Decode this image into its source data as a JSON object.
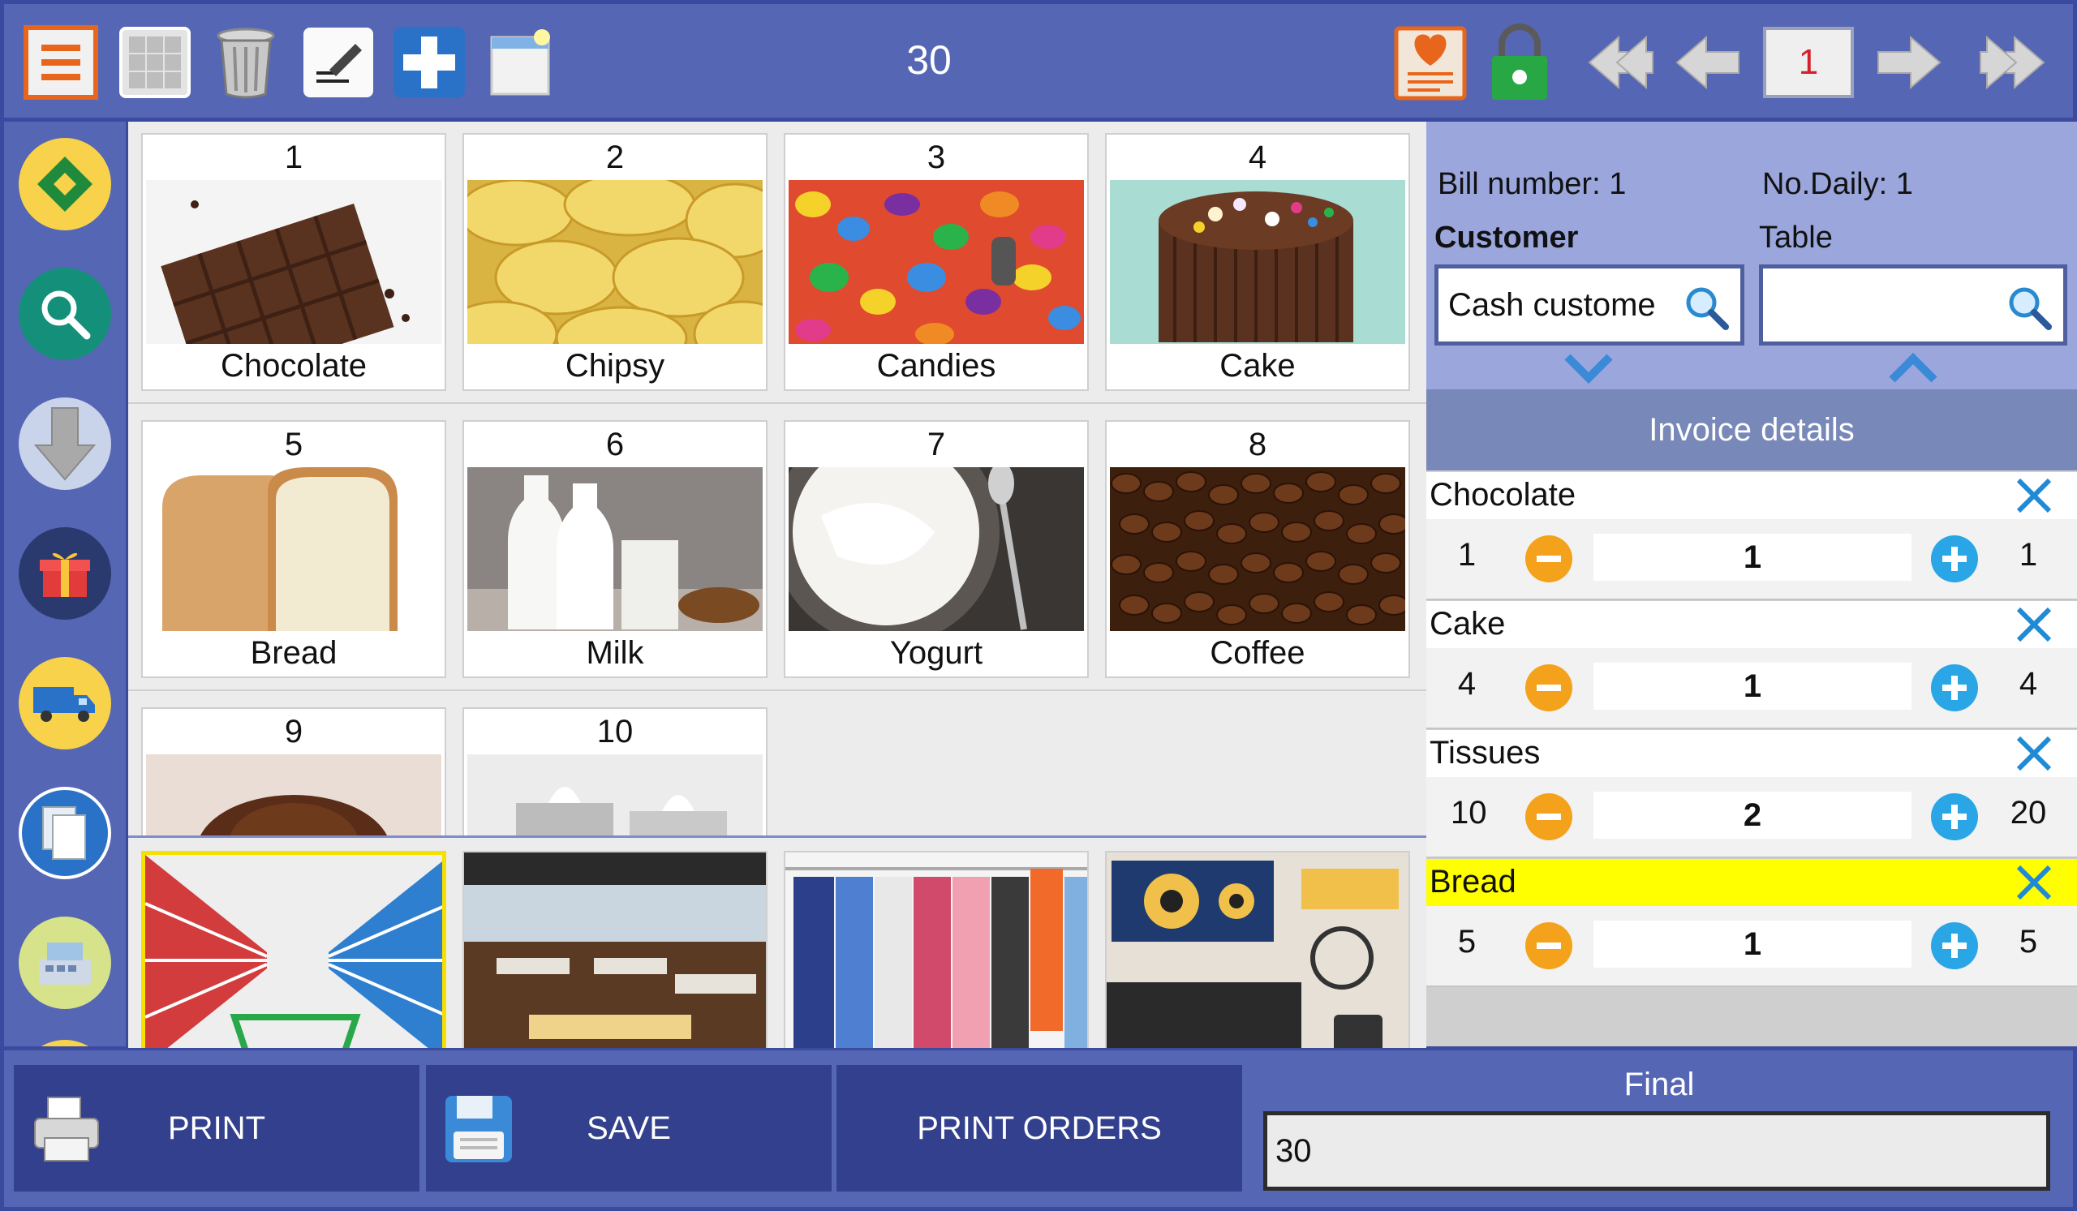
{
  "toolbar": {
    "total": "30",
    "page": "1"
  },
  "products": [
    {
      "num": "1",
      "name": "Chocolate"
    },
    {
      "num": "2",
      "name": "Chipsy"
    },
    {
      "num": "3",
      "name": "Candies"
    },
    {
      "num": "4",
      "name": "Cake"
    },
    {
      "num": "5",
      "name": "Bread"
    },
    {
      "num": "6",
      "name": "Milk"
    },
    {
      "num": "7",
      "name": "Yogurt"
    },
    {
      "num": "8",
      "name": "Coffee"
    },
    {
      "num": "9",
      "name": ""
    },
    {
      "num": "10",
      "name": ""
    }
  ],
  "header": {
    "bill_number": "Bill number: 1",
    "no_daily": "No.Daily: 1",
    "customer_label": "Customer",
    "table_label": "Table",
    "customer_value": "Cash custome",
    "table_value": ""
  },
  "invoice": {
    "title": "Invoice details",
    "items": [
      {
        "name": "Chocolate",
        "code": "1",
        "qty": "1",
        "amount": "1",
        "highlight": false
      },
      {
        "name": "Cake",
        "code": "4",
        "qty": "1",
        "amount": "4",
        "highlight": false
      },
      {
        "name": "Tissues",
        "code": "10",
        "qty": "2",
        "amount": "20",
        "highlight": false
      },
      {
        "name": "Bread",
        "code": "5",
        "qty": "1",
        "amount": "5",
        "highlight": true
      }
    ]
  },
  "bottom": {
    "print_label": "PRINT",
    "save_label": "SAVE",
    "print_orders_label": "PRINT ORDERS",
    "final_label": "Final",
    "final_value": "30"
  },
  "icons": {
    "top": [
      "menu-icon",
      "grid-icon",
      "trash-icon",
      "edit-icon",
      "add-icon",
      "window-icon",
      "favorite-list-icon",
      "lock-icon",
      "first-page-icon",
      "prev-page-icon",
      "next-page-icon",
      "last-page-icon"
    ],
    "side": [
      "diamond-icon",
      "search-icon",
      "download-icon",
      "gift-icon",
      "delivery-truck-icon",
      "documents-icon",
      "cash-register-icon"
    ]
  },
  "colors": {
    "bar": "#5566b5",
    "button": "#33408e",
    "highlight": "#ffff00",
    "minus": "#f4a21c",
    "plus": "#2aa6e6"
  }
}
